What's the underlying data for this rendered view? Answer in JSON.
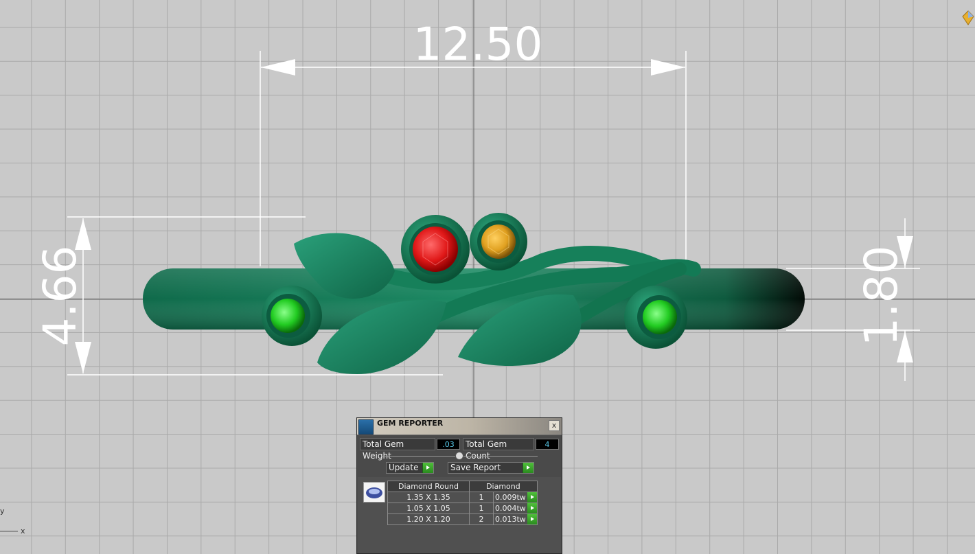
{
  "viewport": {
    "dimensions": {
      "width": "12.50",
      "height": "4.66",
      "thickness": "1.80"
    },
    "axis": {
      "y": "y",
      "x": "x"
    },
    "colors": {
      "background": "#c9c9c9",
      "grid": "#a9a9a9",
      "metal": "#1d8a64",
      "ruby": "#e02020",
      "citrine": "#e0a020",
      "emerald": "#2ccc2c"
    }
  },
  "gem_reporter": {
    "title": "GEM REPORTER",
    "close": "x",
    "total_weight_label": "Total Gem Weight",
    "total_weight_value": ".03",
    "total_count_label": "Total Gem Count",
    "total_count_value": "4",
    "update_label": "Update",
    "save_report_label": "Save Report",
    "table": {
      "headers": [
        "Diamond Round",
        "Diamond"
      ],
      "rows": [
        {
          "size": "1.35 X 1.35",
          "count": "1",
          "weight": "0.009tw"
        },
        {
          "size": "1.05 X 1.05",
          "count": "1",
          "weight": "0.004tw"
        },
        {
          "size": "1.20 X 1.20",
          "count": "2",
          "weight": "0.013tw"
        }
      ]
    }
  }
}
